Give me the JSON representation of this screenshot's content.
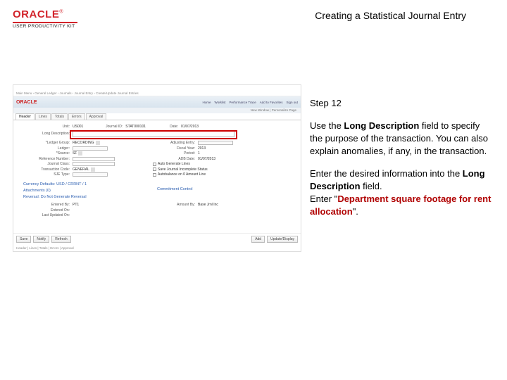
{
  "header": {
    "brand": "ORACLE",
    "upk": "USER PRODUCTIVITY KIT",
    "title": "Creating a Statistical Journal Entry"
  },
  "instructions": {
    "step_label": "Step 12",
    "p1_a": "Use the ",
    "p1_b": "Long Description",
    "p1_c": " field to specify the purpose of the transaction. You can also explain anomalies, if any, in the transaction.",
    "p2_a": "Enter the desired information into the ",
    "p2_b": "Long Description",
    "p2_c": " field.",
    "p3_a": "Enter \"",
    "p3_b": "Department square footage for rent allocation",
    "p3_c": "\"."
  },
  "shot": {
    "breadcrumb": "Main Menu › General Ledger › Journals › Journal Entry › Create/Update Journal Entries",
    "brand": "ORACLE",
    "topnav": [
      "Home",
      "Worklist",
      "Performance Trace",
      "Add to Favorites",
      "Sign out"
    ],
    "subbar": "New Window | Personalize Page",
    "tabs": [
      "Header",
      "Lines",
      "Totals",
      "Errors",
      "Approval"
    ],
    "unit_lbl": "Unit:",
    "unit_val": "US001",
    "jid_lbl": "Journal ID:",
    "jid_val": "STAT000101",
    "date_lbl": "Date:",
    "date_val": "01/07/2013",
    "ld_lbl": "Long Description:",
    "lgrp_lbl": "*Ledger Group:",
    "lgrp_val": "RECORDING",
    "ledger_lbl": "Ledger:",
    "adj_lbl": "Adjusting Entry:",
    "fy_lbl": "Fiscal Year:",
    "fy_val": "2013",
    "period_lbl": "Period:",
    "period_val": "1",
    "source_lbl": "*Source:",
    "source_val": "SF",
    "adb_lbl": "ADB Date:",
    "adb_val": "01/07/2013",
    "refno_lbl": "Reference Number:",
    "jclass_lbl": "Journal Class:",
    "tcode_lbl": "Transaction Code:",
    "tcode_val": "GENERAL",
    "autogen_lbl": "Auto Generate Lines",
    "sjh_lbl": "SJE Type:",
    "save_lbl": "Save Journal Incomplete Status",
    "agopt_lbl": "Autobalance on 0 Amount Line",
    "cur_lbl": "Currency Defaults: USD / CRRNT / 1",
    "att_lbl": "Attachments (0)",
    "rev_lbl": "Reversal: Do Not Generate Reversal",
    "com_lbl": "Commitment Control",
    "entby_lbl": "Entered By:",
    "entby_val": "PT1",
    "enton_lbl": "Entered On:",
    "lastup_lbl": "Last Updated On:",
    "amtby_lbl": "Amount By:",
    "amtby_val": "Base Jrnl Inc",
    "save": "Save",
    "notify": "Notify",
    "refresh": "Refresh",
    "add": "Add",
    "update": "Update/Display",
    "foot": "Header | Lines | Totals | Errors | Approval"
  }
}
